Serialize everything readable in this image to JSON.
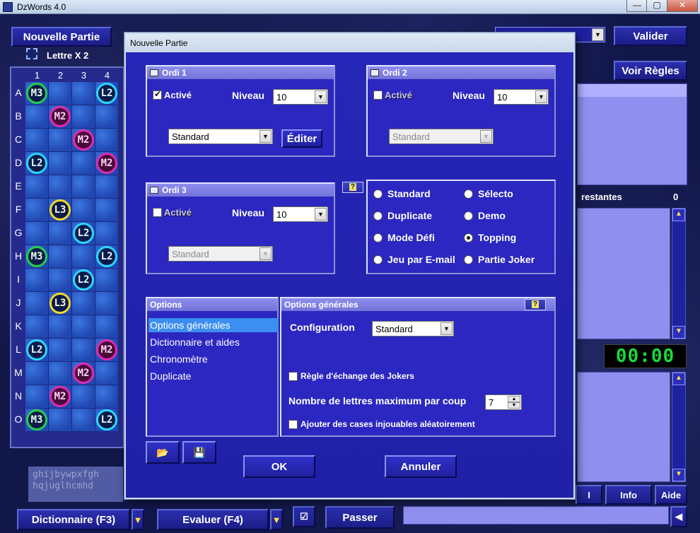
{
  "window": {
    "title": "DzWords 4.0",
    "minimize": "—",
    "maximize": "▢",
    "close": "✕"
  },
  "toolbar": {
    "new_game": "Nouvelle Partie",
    "validate": "Valider",
    "rules": "Voir Règles",
    "legend_letter_x2": "Lettre X 2",
    "remaining_label": "restantes",
    "remaining_count": "0",
    "timer": "00:00",
    "info": "Info",
    "help": "Aide",
    "i_button": "I",
    "dictionary": "Dictionnaire (F3)",
    "evaluate": "Evaluer (F4)",
    "pass": "Passer"
  },
  "board": {
    "columns": [
      "1",
      "2",
      "3",
      "4"
    ],
    "rows": [
      "A",
      "B",
      "C",
      "D",
      "E",
      "F",
      "G",
      "H",
      "I",
      "J",
      "K",
      "L",
      "M",
      "N",
      "O"
    ],
    "bonuses": [
      {
        "row": 0,
        "col": 0,
        "type": "m3",
        "label": "M3"
      },
      {
        "row": 0,
        "col": 3,
        "type": "l2",
        "label": "L2"
      },
      {
        "row": 1,
        "col": 1,
        "type": "m2",
        "label": "M2"
      },
      {
        "row": 2,
        "col": 2,
        "type": "m2",
        "label": "M2"
      },
      {
        "row": 3,
        "col": 0,
        "type": "l2",
        "label": "L2"
      },
      {
        "row": 3,
        "col": 3,
        "type": "m2",
        "label": "M2"
      },
      {
        "row": 5,
        "col": 1,
        "type": "l3",
        "label": "L3"
      },
      {
        "row": 6,
        "col": 2,
        "type": "l2",
        "label": "L2"
      },
      {
        "row": 7,
        "col": 0,
        "type": "m3",
        "label": "M3"
      },
      {
        "row": 7,
        "col": 3,
        "type": "l2",
        "label": "L2"
      },
      {
        "row": 8,
        "col": 2,
        "type": "l2",
        "label": "L2"
      },
      {
        "row": 9,
        "col": 1,
        "type": "l3",
        "label": "L3"
      },
      {
        "row": 11,
        "col": 0,
        "type": "l2",
        "label": "L2"
      },
      {
        "row": 11,
        "col": 3,
        "type": "m2",
        "label": "M2"
      },
      {
        "row": 12,
        "col": 2,
        "type": "m2",
        "label": "M2"
      },
      {
        "row": 13,
        "col": 1,
        "type": "m2",
        "label": "M2"
      },
      {
        "row": 14,
        "col": 0,
        "type": "m3",
        "label": "M3"
      },
      {
        "row": 14,
        "col": 3,
        "type": "l2",
        "label": "L2"
      }
    ],
    "logo_text": "ghijbywpxfgh\nhqjuglhcmhd\nlqrbflgqkfv"
  },
  "dialog": {
    "title": "Nouvelle Partie",
    "ordi1": {
      "title": "Ordi 1",
      "active": "Activé",
      "level_label": "Niveau",
      "level": "10",
      "profile": "Standard",
      "edit": "Éditer"
    },
    "ordi2": {
      "title": "Ordi 2",
      "active": "Activé",
      "level_label": "Niveau",
      "level": "10",
      "profile": "Standard"
    },
    "ordi3": {
      "title": "Ordi 3",
      "active": "Activé",
      "level_label": "Niveau",
      "level": "10",
      "profile": "Standard"
    },
    "modes": [
      "Standard",
      "Sélecto",
      "Duplicate",
      "Demo",
      "Mode Défi",
      "Topping",
      "Jeu par E-mail",
      "Partie Joker"
    ],
    "selected_mode": "Topping",
    "help_glyph": "?",
    "options": {
      "title": "Options",
      "items": [
        "Options générales",
        "Dictionnaire et aides",
        "Chronomètre",
        "Duplicate"
      ],
      "selected": "Options générales"
    },
    "general": {
      "title": "Options générales",
      "config_label": "Configuration",
      "config_value": "Standard",
      "joker_rule": "Règle d'échange des Jokers",
      "max_letters_label": "Nombre de lettres maximum par coup",
      "max_letters": "7",
      "random_cells": "Ajouter des cases injouables aléatoirement"
    },
    "ok": "OK",
    "cancel": "Annuler"
  }
}
